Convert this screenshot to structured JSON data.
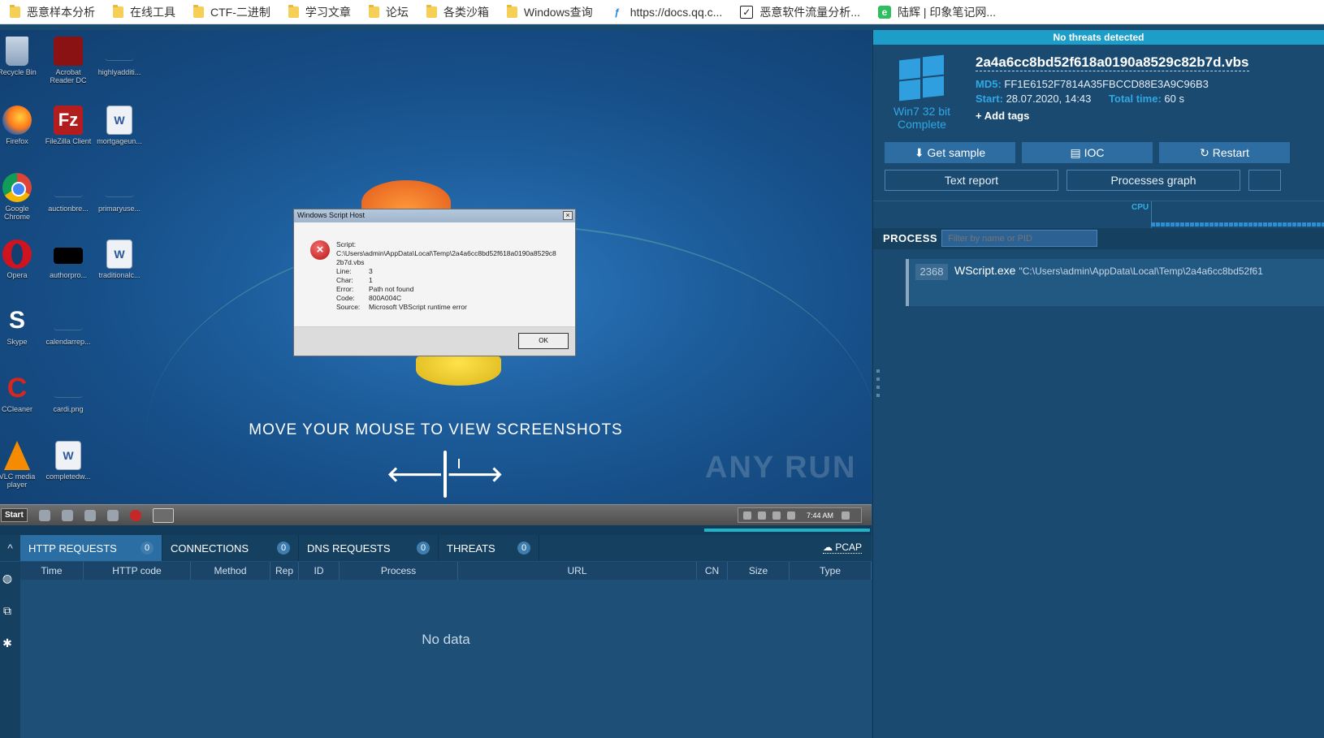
{
  "bookmarks": [
    {
      "label": "恶意样本分析",
      "icon": "folder-icon"
    },
    {
      "label": "在线工具",
      "icon": "folder-icon"
    },
    {
      "label": "CTF-二进制",
      "icon": "folder-icon"
    },
    {
      "label": "学习文章",
      "icon": "folder-icon"
    },
    {
      "label": "论坛",
      "icon": "folder-icon"
    },
    {
      "label": "各类沙箱",
      "icon": "folder-icon"
    },
    {
      "label": "Windows查询",
      "icon": "folder-icon"
    },
    {
      "label": "https://docs.qq.c...",
      "icon": "qq-docs-icon"
    },
    {
      "label": "恶意软件流量分析...",
      "icon": "checkbox-icon"
    },
    {
      "label": "陆辉 | 印象笔记网...",
      "icon": "evernote-icon"
    }
  ],
  "desktop": {
    "icons": [
      {
        "label": "Recycle Bin",
        "kind": "bin"
      },
      {
        "label": "Acrobat Reader DC",
        "kind": "pdf"
      },
      {
        "label": "highlyadditi...",
        "kind": "blank"
      },
      {
        "label": "Firefox",
        "kind": "ff"
      },
      {
        "label": "FileZilla Client",
        "kind": "fz"
      },
      {
        "label": "mortgageun...",
        "kind": "doc"
      },
      {
        "label": "Google Chrome",
        "kind": "chrome"
      },
      {
        "label": "auctionbre...",
        "kind": "blank"
      },
      {
        "label": "primaryuse...",
        "kind": "blank"
      },
      {
        "label": "Opera",
        "kind": "opera"
      },
      {
        "label": "authorpro...",
        "kind": "black"
      },
      {
        "label": "traditionalc...",
        "kind": "doc"
      },
      {
        "label": "Skype",
        "kind": "skype"
      },
      {
        "label": "calendarrep...",
        "kind": "blank"
      },
      {
        "label": "CCleaner",
        "kind": "cc"
      },
      {
        "label": "cardi.png",
        "kind": "blank"
      },
      {
        "label": "VLC media player",
        "kind": "vlc"
      },
      {
        "label": "completedw...",
        "kind": "doc"
      }
    ],
    "dialog": {
      "title": "Windows Script Host",
      "script_label": "Script:",
      "script_path": "C:\\Users\\admin\\AppData\\Local\\Temp\\2a4a6cc8bd52f618a0190a8529c82b7d.vbs",
      "rows": [
        {
          "k": "Line:",
          "v": "3"
        },
        {
          "k": "Char:",
          "v": "1"
        },
        {
          "k": "Error:",
          "v": "Path not found"
        },
        {
          "k": "Code:",
          "v": "800A004C"
        },
        {
          "k": "Source:",
          "v": "Microsoft VBScript runtime error"
        }
      ],
      "ok_label": "OK"
    },
    "hint": "MOVE YOUR MOUSE TO VIEW SCREENSHOTS",
    "watermark": "ANY RUN",
    "taskbar": {
      "start_label": "Start",
      "clock": "7:44 AM"
    },
    "progress": 0.19
  },
  "bottom": {
    "tabs": [
      {
        "label": "HTTP REQUESTS",
        "count": "0"
      },
      {
        "label": "CONNECTIONS",
        "count": "0"
      },
      {
        "label": "DNS REQUESTS",
        "count": "0"
      },
      {
        "label": "THREATS",
        "count": "0"
      }
    ],
    "pcap_label": "PCAP",
    "columns": [
      "Time",
      "HTTP code",
      "Method",
      "Rep",
      "ID",
      "Process",
      "URL",
      "CN",
      "Size",
      "Type"
    ],
    "empty_text": "No data"
  },
  "right": {
    "verdict": "No threats detected",
    "os_line1": "Win7 32 bit",
    "os_line2": "Complete",
    "filename": "2a4a6cc8bd52f618a0190a8529c82b7d.vbs",
    "md5_label": "MD5:",
    "md5": "FF1E6152F7814A35FBCCD88E3A9C96B3",
    "start_label": "Start:",
    "start": "28.07.2020, 14:43",
    "total_label": "Total time:",
    "total": "60 s",
    "add_tags": "Add tags",
    "buttons_row1": [
      "Get sample",
      "IOC",
      "Restart"
    ],
    "buttons_row2": [
      "Text report",
      "Processes graph"
    ],
    "cpu_label": "CPU",
    "process_title": "PROCESS",
    "filter_placeholder": "Filter by name or PID",
    "process": {
      "pid": "2368",
      "name": "WScript.exe",
      "cmd": "\"C:\\Users\\admin\\AppData\\Local\\Temp\\2a4a6cc8bd52f61"
    },
    "colors": {
      "verdict_bg": "#1d9ec9",
      "accent": "#2fa8e6"
    }
  }
}
